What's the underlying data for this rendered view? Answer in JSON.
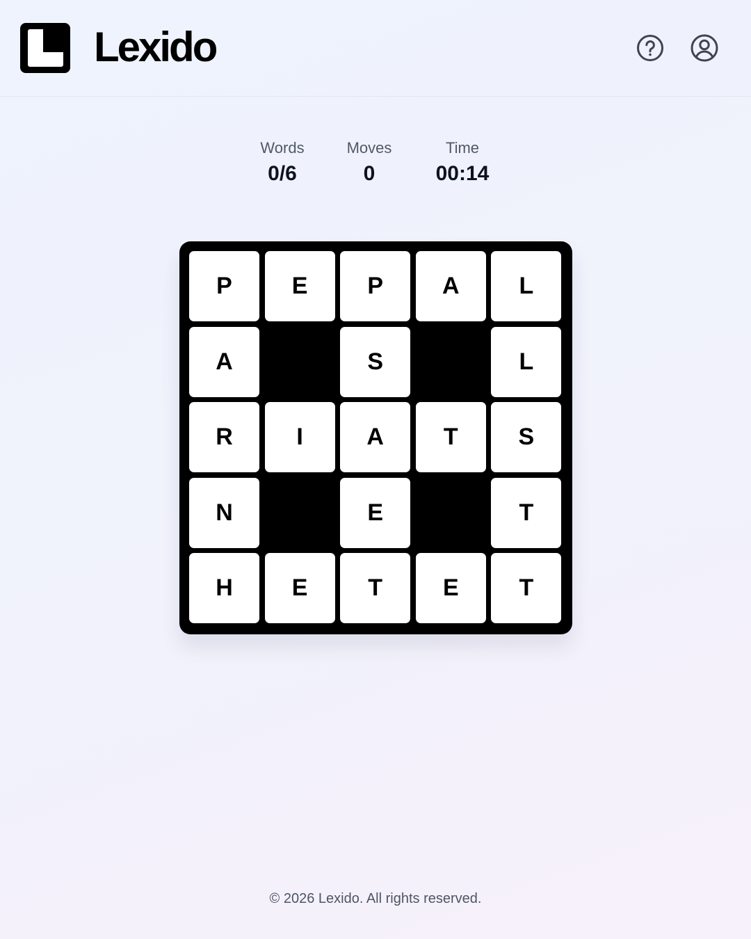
{
  "app": {
    "name": "Lexido"
  },
  "header": {
    "help_icon": "help-circle-icon",
    "account_icon": "user-circle-icon"
  },
  "stats": {
    "words": {
      "label": "Words",
      "value": "0/6"
    },
    "moves": {
      "label": "Moves",
      "value": "0"
    },
    "time": {
      "label": "Time",
      "value": "00:14"
    }
  },
  "board": {
    "size": 5,
    "rows": [
      [
        "P",
        "E",
        "P",
        "A",
        "L"
      ],
      [
        "A",
        null,
        "S",
        null,
        "L"
      ],
      [
        "R",
        "I",
        "A",
        "T",
        "S"
      ],
      [
        "N",
        null,
        "E",
        null,
        "T"
      ],
      [
        "H",
        "E",
        "T",
        "E",
        "T"
      ]
    ]
  },
  "footer": {
    "copyright": "© 2026 Lexido. All rights reserved."
  },
  "colors": {
    "board": "#000000",
    "tile": "#ffffff",
    "text": "#111111",
    "muted": "#525866"
  }
}
